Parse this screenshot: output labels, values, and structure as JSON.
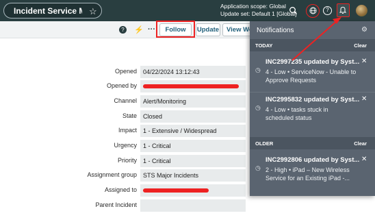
{
  "header": {
    "app_title": "Incident Service Mana...",
    "scope_line1": "Application scope: Global",
    "scope_line2": "Update set: Default 1 [Global]",
    "icons": [
      "star-icon",
      "search-icon",
      "globe-icon",
      "help-icon",
      "bell-icon",
      "avatar"
    ]
  },
  "toolbar": {
    "info_glyph": "?",
    "pulse_glyph": "⚡",
    "more_glyph": "···",
    "follow_label": "Follow",
    "update_label": "Update",
    "view_label": "View Wo"
  },
  "form": {
    "fields": [
      {
        "label": "Opened",
        "value": "04/22/2024 13:12:43"
      },
      {
        "label": "Opened by",
        "value": ""
      },
      {
        "label": "Channel",
        "value": "Alert/Monitoring"
      },
      {
        "label": "State",
        "value": "Closed"
      },
      {
        "label": "Impact",
        "value": "1 - Extensive / Widespread"
      },
      {
        "label": "Urgency",
        "value": "1 - Critical"
      },
      {
        "label": "Priority",
        "value": "1 - Critical"
      },
      {
        "label": "Assignment group",
        "value": "STS Major Incidents"
      },
      {
        "label": "Assigned to",
        "value": ""
      },
      {
        "label": "Parent Incident",
        "value": ""
      }
    ]
  },
  "notifications": {
    "title": "Notifications",
    "today_label": "TODAY",
    "older_label": "OLDER",
    "clear_label": "Clear",
    "today": [
      {
        "title": "INC2997235 updated by Syst...",
        "body": "4 - Low • ServiceNow - Unable to Approve Requests"
      },
      {
        "title": "INC2995832 updated by Syst...",
        "body": "4 - Low • tasks stuck in scheduled status"
      }
    ],
    "older": [
      {
        "title": "INC2992806 updated by Syst...",
        "body": "2 - High • iPad – New Wireless Service for an Existing iPad -..."
      }
    ]
  },
  "colors": {
    "header_bg": "#293e40",
    "highlight": "#e22222",
    "panel_bg": "#5a6470"
  }
}
